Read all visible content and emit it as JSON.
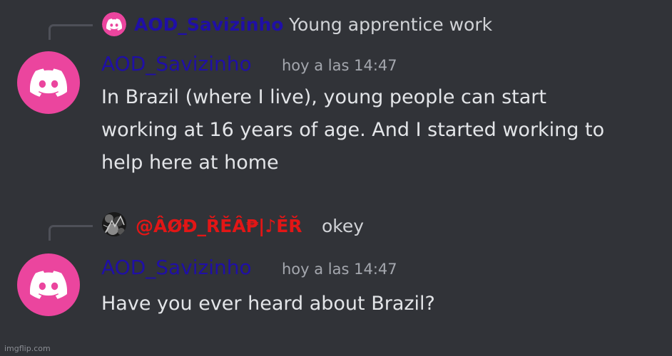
{
  "theme": {
    "background": "#313338",
    "brand_pink": "#eb459e",
    "username_color": "#1f0fa6",
    "reaper_color": "#e21616",
    "icon": "discord-logo-icon"
  },
  "messages": [
    {
      "reply": {
        "author": "AOD_Savizinho",
        "text": "Young apprentice work"
      },
      "author": "AOD_Savizinho",
      "timestamp": "hoy a las 14:47",
      "lines": [
        "In Brazil (where I live), young people can start",
        "working at 16 years of age. And I started working to",
        "help here at home"
      ]
    },
    {
      "reply": {
        "author": "@ÂØĐ_ŘĚÂ₱|♪ĚŘ",
        "text": "okey"
      },
      "author": "AOD_Savizinho",
      "timestamp": "hoy a las 14:47",
      "lines": [
        "Have you ever heard about Brazil?"
      ]
    }
  ],
  "watermark": "imgflip.com"
}
